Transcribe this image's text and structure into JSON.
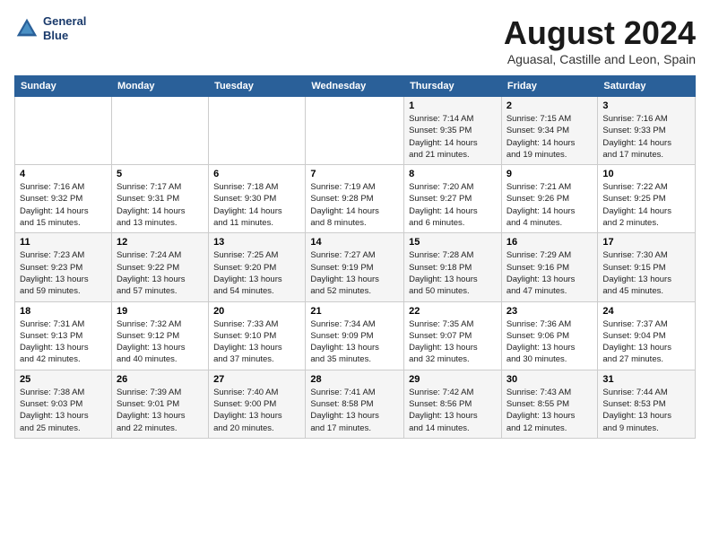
{
  "header": {
    "logo_line1": "General",
    "logo_line2": "Blue",
    "month": "August 2024",
    "location": "Aguasal, Castille and Leon, Spain"
  },
  "weekdays": [
    "Sunday",
    "Monday",
    "Tuesday",
    "Wednesday",
    "Thursday",
    "Friday",
    "Saturday"
  ],
  "weeks": [
    [
      {
        "day": "",
        "info": ""
      },
      {
        "day": "",
        "info": ""
      },
      {
        "day": "",
        "info": ""
      },
      {
        "day": "",
        "info": ""
      },
      {
        "day": "1",
        "info": "Sunrise: 7:14 AM\nSunset: 9:35 PM\nDaylight: 14 hours\nand 21 minutes."
      },
      {
        "day": "2",
        "info": "Sunrise: 7:15 AM\nSunset: 9:34 PM\nDaylight: 14 hours\nand 19 minutes."
      },
      {
        "day": "3",
        "info": "Sunrise: 7:16 AM\nSunset: 9:33 PM\nDaylight: 14 hours\nand 17 minutes."
      }
    ],
    [
      {
        "day": "4",
        "info": "Sunrise: 7:16 AM\nSunset: 9:32 PM\nDaylight: 14 hours\nand 15 minutes."
      },
      {
        "day": "5",
        "info": "Sunrise: 7:17 AM\nSunset: 9:31 PM\nDaylight: 14 hours\nand 13 minutes."
      },
      {
        "day": "6",
        "info": "Sunrise: 7:18 AM\nSunset: 9:30 PM\nDaylight: 14 hours\nand 11 minutes."
      },
      {
        "day": "7",
        "info": "Sunrise: 7:19 AM\nSunset: 9:28 PM\nDaylight: 14 hours\nand 8 minutes."
      },
      {
        "day": "8",
        "info": "Sunrise: 7:20 AM\nSunset: 9:27 PM\nDaylight: 14 hours\nand 6 minutes."
      },
      {
        "day": "9",
        "info": "Sunrise: 7:21 AM\nSunset: 9:26 PM\nDaylight: 14 hours\nand 4 minutes."
      },
      {
        "day": "10",
        "info": "Sunrise: 7:22 AM\nSunset: 9:25 PM\nDaylight: 14 hours\nand 2 minutes."
      }
    ],
    [
      {
        "day": "11",
        "info": "Sunrise: 7:23 AM\nSunset: 9:23 PM\nDaylight: 13 hours\nand 59 minutes."
      },
      {
        "day": "12",
        "info": "Sunrise: 7:24 AM\nSunset: 9:22 PM\nDaylight: 13 hours\nand 57 minutes."
      },
      {
        "day": "13",
        "info": "Sunrise: 7:25 AM\nSunset: 9:20 PM\nDaylight: 13 hours\nand 54 minutes."
      },
      {
        "day": "14",
        "info": "Sunrise: 7:27 AM\nSunset: 9:19 PM\nDaylight: 13 hours\nand 52 minutes."
      },
      {
        "day": "15",
        "info": "Sunrise: 7:28 AM\nSunset: 9:18 PM\nDaylight: 13 hours\nand 50 minutes."
      },
      {
        "day": "16",
        "info": "Sunrise: 7:29 AM\nSunset: 9:16 PM\nDaylight: 13 hours\nand 47 minutes."
      },
      {
        "day": "17",
        "info": "Sunrise: 7:30 AM\nSunset: 9:15 PM\nDaylight: 13 hours\nand 45 minutes."
      }
    ],
    [
      {
        "day": "18",
        "info": "Sunrise: 7:31 AM\nSunset: 9:13 PM\nDaylight: 13 hours\nand 42 minutes."
      },
      {
        "day": "19",
        "info": "Sunrise: 7:32 AM\nSunset: 9:12 PM\nDaylight: 13 hours\nand 40 minutes."
      },
      {
        "day": "20",
        "info": "Sunrise: 7:33 AM\nSunset: 9:10 PM\nDaylight: 13 hours\nand 37 minutes."
      },
      {
        "day": "21",
        "info": "Sunrise: 7:34 AM\nSunset: 9:09 PM\nDaylight: 13 hours\nand 35 minutes."
      },
      {
        "day": "22",
        "info": "Sunrise: 7:35 AM\nSunset: 9:07 PM\nDaylight: 13 hours\nand 32 minutes."
      },
      {
        "day": "23",
        "info": "Sunrise: 7:36 AM\nSunset: 9:06 PM\nDaylight: 13 hours\nand 30 minutes."
      },
      {
        "day": "24",
        "info": "Sunrise: 7:37 AM\nSunset: 9:04 PM\nDaylight: 13 hours\nand 27 minutes."
      }
    ],
    [
      {
        "day": "25",
        "info": "Sunrise: 7:38 AM\nSunset: 9:03 PM\nDaylight: 13 hours\nand 25 minutes."
      },
      {
        "day": "26",
        "info": "Sunrise: 7:39 AM\nSunset: 9:01 PM\nDaylight: 13 hours\nand 22 minutes."
      },
      {
        "day": "27",
        "info": "Sunrise: 7:40 AM\nSunset: 9:00 PM\nDaylight: 13 hours\nand 20 minutes."
      },
      {
        "day": "28",
        "info": "Sunrise: 7:41 AM\nSunset: 8:58 PM\nDaylight: 13 hours\nand 17 minutes."
      },
      {
        "day": "29",
        "info": "Sunrise: 7:42 AM\nSunset: 8:56 PM\nDaylight: 13 hours\nand 14 minutes."
      },
      {
        "day": "30",
        "info": "Sunrise: 7:43 AM\nSunset: 8:55 PM\nDaylight: 13 hours\nand 12 minutes."
      },
      {
        "day": "31",
        "info": "Sunrise: 7:44 AM\nSunset: 8:53 PM\nDaylight: 13 hours\nand 9 minutes."
      }
    ]
  ]
}
